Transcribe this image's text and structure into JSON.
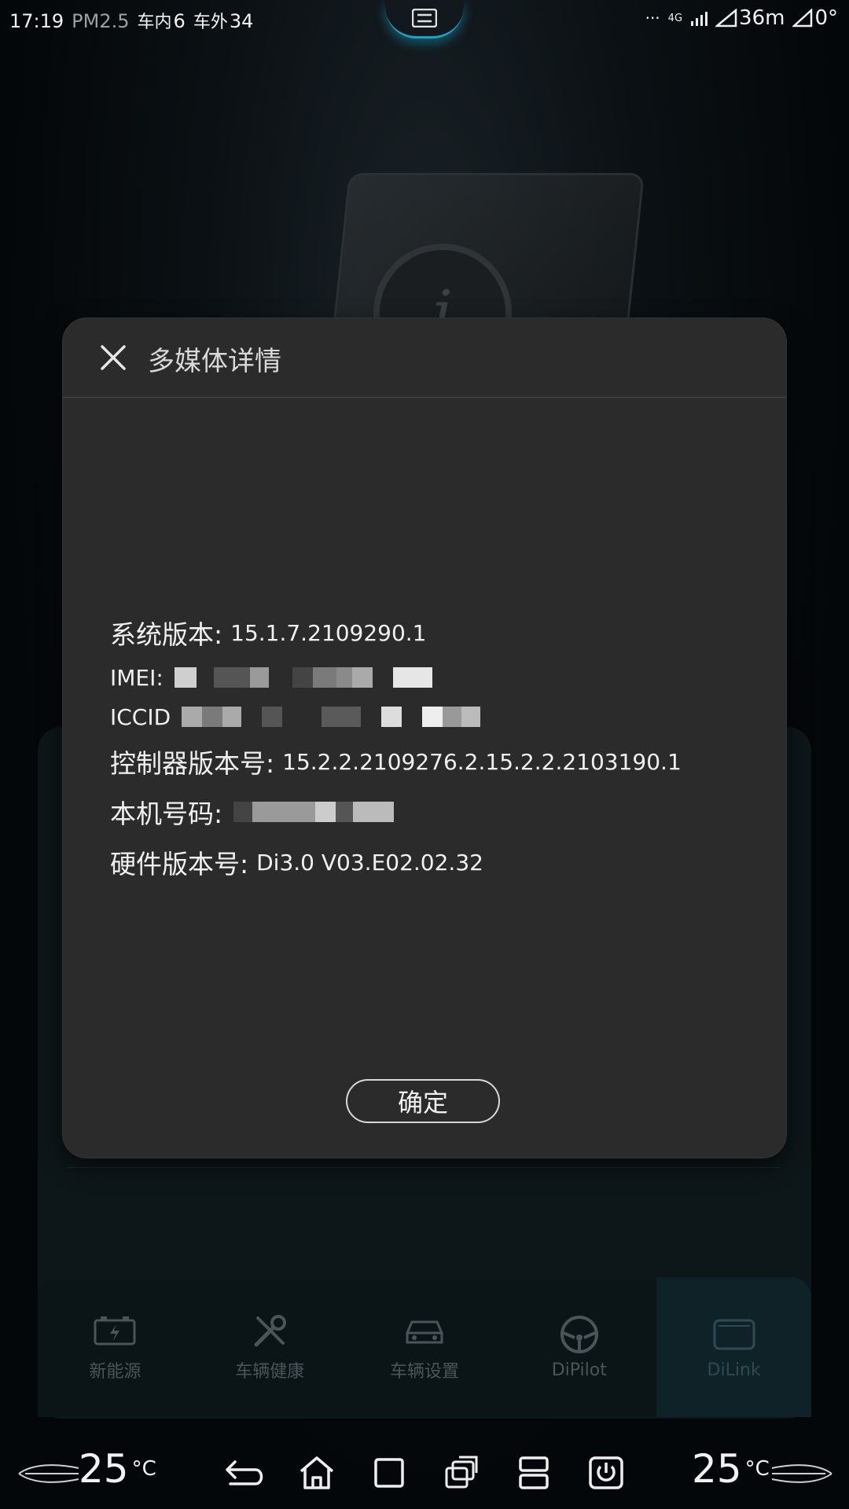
{
  "status_bar": {
    "time": "17:19",
    "pm25_label": "PM2.5",
    "indoor_label": "车内",
    "indoor_value": "6",
    "outdoor_label": "车外",
    "outdoor_value": "34",
    "network": "4G",
    "more": "···",
    "distance": "36m",
    "temp_reading": "0°"
  },
  "dialog": {
    "title": "多媒体详情",
    "rows": [
      {
        "label": "系统版本:",
        "value": "15.1.7.2109290.1"
      },
      {
        "label": "IMEI:",
        "value": ""
      },
      {
        "label": "ICCID",
        "value": ""
      },
      {
        "label": "控制器版本号:",
        "value": "15.2.2.2109276.2.15.2.2.2103190.1"
      },
      {
        "label": "本机号码:",
        "value": ""
      },
      {
        "label": "硬件版本号:",
        "value": "Di3.0 V03.E02.02.32"
      }
    ],
    "ok_label": "确定"
  },
  "tabs": [
    {
      "label": "新能源",
      "icon": "battery-icon"
    },
    {
      "label": "车辆健康",
      "icon": "tools-icon"
    },
    {
      "label": "车辆设置",
      "icon": "car-icon"
    },
    {
      "label": "DiPilot",
      "icon": "steering-wheel-icon"
    },
    {
      "label": "DiLink",
      "icon": "screen-icon"
    }
  ],
  "bottom_nav": {
    "left_temp": "25",
    "right_temp": "25",
    "temp_unit": "°C",
    "icons": [
      "back-icon",
      "home-icon",
      "recents-icon",
      "multi-window-icon",
      "split-screen-icon",
      "power-icon"
    ]
  },
  "colors": {
    "accent": "#1aa3c8",
    "dialog_bg": "#2b2b2b",
    "background": "#05090c"
  }
}
